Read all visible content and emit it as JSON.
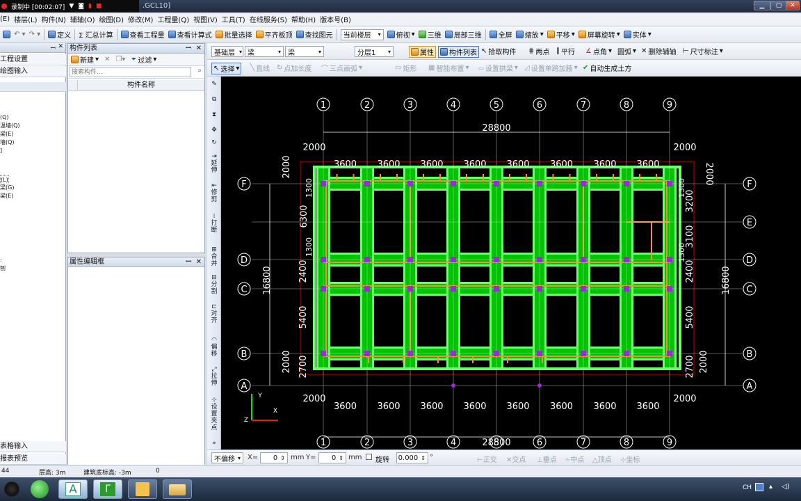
{
  "titlebar": {
    "recording_label": "录制中 [00:02:07]",
    "file_title": ".GCL10]"
  },
  "menu": [
    "(E)",
    "楼层(L)",
    "构件(N)",
    "辅轴(O)",
    "绘图(D)",
    "修改(M)",
    "工程量(Q)",
    "视图(V)",
    "工具(T)",
    "在线服务(S)",
    "帮助(H)",
    "版本号(B)"
  ],
  "toolbar1": {
    "define": "定义",
    "sum_calc": "Σ 汇总计算",
    "view_qty": "查看工程量",
    "view_formula": "查看计算式",
    "batch_select": "批量选择",
    "flat_top": "平齐板顶",
    "find_elem": "查找图元",
    "floor_select": "当前楼层",
    "top_view": "俯视",
    "three_d": "三维",
    "local_3d": "局部三维",
    "full_screen": "全屏",
    "zoom": "缩放",
    "pan": "平移",
    "screen_rotate": "屏幕旋转",
    "solid": "实体"
  },
  "left_panel": {
    "row1": "工程设置",
    "row2": "绘图输入",
    "items": [
      "(Q)",
      "温墙(Q)",
      "梁(E)",
      "墙(Q)",
      "]",
      "",
      "(L)",
      "梁(G)",
      "梁(E)",
      "",
      "",
      ""
    ],
    "bottom1": "表格输入",
    "bottom2": "报表预览"
  },
  "component_list": {
    "header": "构件列表",
    "new_label": "新建",
    "filter_label": "过滤",
    "search_placeholder": "搜索构件...",
    "column_header": "构件名称"
  },
  "property_panel": {
    "header": "属性编辑框"
  },
  "toolbar2": {
    "floor": "基础层",
    "type": "梁",
    "subtype": "梁",
    "layer": "分层1",
    "property": "属性",
    "comp_list": "构件列表",
    "pick": "拾取构件",
    "two_point": "两点",
    "parallel": "平行",
    "point_angle": "点角",
    "arc": "圆弧",
    "del_aux": "删除辅轴",
    "dim": "尺寸标注"
  },
  "toolbar3": {
    "select": "选择",
    "line": "直线",
    "point_extend": "点加长度",
    "three_arc": "三点画弧",
    "rect": "矩形",
    "smart": "智能布置",
    "set_support": "设置拱梁",
    "set_span": "设置单跨加腋",
    "auto_earth": "自动生成土方"
  },
  "vertical_tools": [
    "延伸",
    "修剪",
    "打断",
    "合并",
    "分割",
    "对齐",
    "偏移",
    "拉伸",
    "设置夹点"
  ],
  "statusbar1": {
    "offset": "不偏移",
    "x_label": "X=",
    "x_value": "0",
    "mm1": "mm",
    "y_label": "Y=",
    "y_value": "0",
    "mm2": "mm",
    "rotate": "旋转",
    "rotate_value": "0.000",
    "ortho": "正交",
    "intersect": "交点",
    "perp": "垂点",
    "mid": "中点",
    "top": "顶点",
    "coord": "坐标"
  },
  "statusbar2": {
    "left_value": "44",
    "floor_height": "层高: 3m",
    "base_elev": "建筑底标高: -3m",
    "zero": "0"
  },
  "tray": {
    "lang": "CH"
  },
  "drawing": {
    "top_axes": [
      "1",
      "2",
      "3",
      "4",
      "5",
      "6",
      "7",
      "8",
      "9"
    ],
    "row_axes": [
      "F",
      "E",
      "D",
      "C",
      "B",
      "A"
    ],
    "total_width": "28800",
    "spans": [
      "3600",
      "3600",
      "3600",
      "3600",
      "3600",
      "3600",
      "3600",
      "3600"
    ],
    "left_dims": [
      "2000",
      "2000",
      "1300",
      "6300",
      "1300",
      "2400",
      "5400",
      "2000",
      "2700",
      "2000"
    ],
    "total_height": "16800",
    "right_dims": [
      "2000",
      "1300",
      "3200",
      "3100",
      "1300",
      "2400",
      "5400",
      "2700",
      "2000"
    ],
    "corner_dims": [
      "2000",
      "2000",
      "2000",
      "2000"
    ],
    "colors": {
      "beam_green": "#00c400",
      "beam_light": "#6cff6c",
      "axis_white": "#ffffff",
      "column_purple": "#9b2bd6",
      "rebar_orange": "#ff8a3c",
      "bound_red": "#c00000"
    }
  }
}
